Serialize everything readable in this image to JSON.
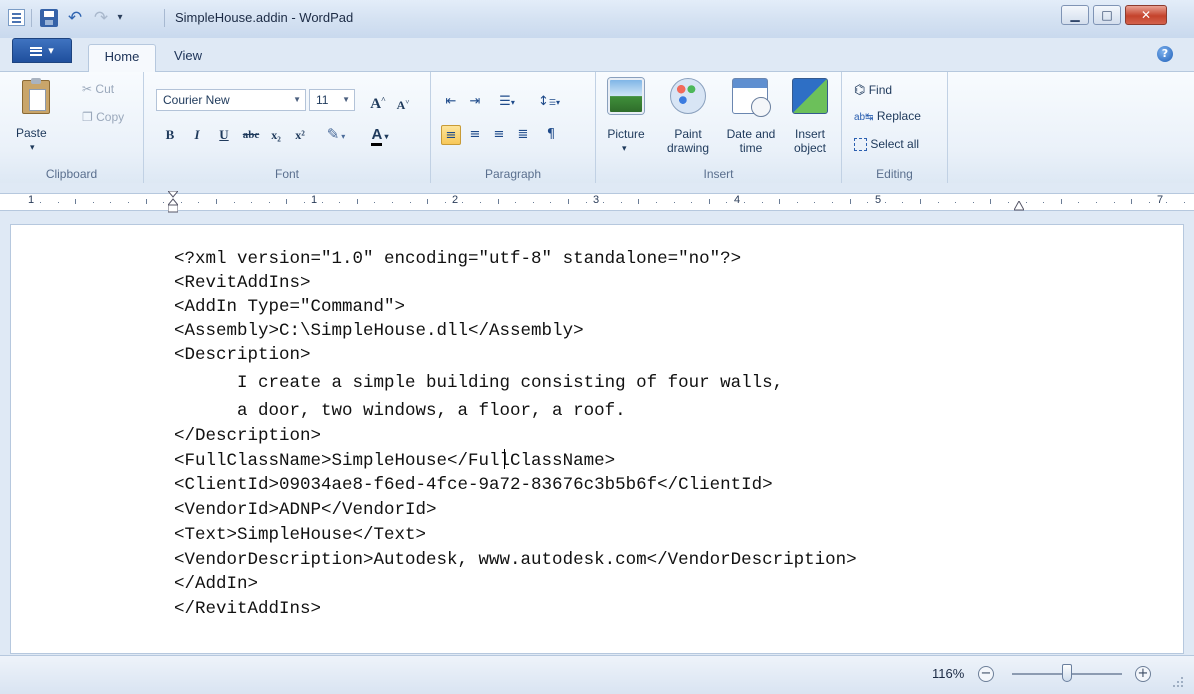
{
  "window": {
    "title": "SimpleHouse.addin - WordPad",
    "app_icon": "wordpad-icon",
    "quick_access": [
      "save-icon",
      "undo-icon",
      "redo-icon",
      "customize-dropdown-icon"
    ],
    "controls": {
      "minimize": "▁",
      "maximize": "□",
      "close": "✕"
    }
  },
  "ribbon": {
    "tabs": [
      {
        "label": "Home",
        "selected": true
      },
      {
        "label": "View",
        "selected": false
      }
    ],
    "help": "?",
    "clipboard": {
      "paste": "Paste",
      "cut": "Cut",
      "copy": "Copy",
      "group_label": "Clipboard"
    },
    "font": {
      "family": "Courier New",
      "size": "11",
      "grow": "A",
      "shrink": "A",
      "bold": "B",
      "italic": "I",
      "underline": "U",
      "strikethrough": "abc",
      "subscript": "x₂",
      "superscript": "x²",
      "color_letter": "A",
      "group_label": "Font"
    },
    "paragraph": {
      "group_label": "Paragraph",
      "active_alignment": "left"
    },
    "insert": {
      "picture": "Picture",
      "paint": [
        "Paint",
        "drawing"
      ],
      "datetime": [
        "Date and",
        "time"
      ],
      "object": [
        "Insert",
        "object"
      ],
      "group_label": "Insert"
    },
    "editing": {
      "find": "Find",
      "replace": "Replace",
      "select_all": "Select all",
      "group_label": "Editing"
    }
  },
  "ruler": {
    "numbers": [
      "1",
      "1",
      "2",
      "3",
      "4",
      "5",
      "7"
    ]
  },
  "document": {
    "lines": [
      "<?xml version=\"1.0\" encoding=\"utf-8\" standalone=\"no\"?>",
      "<RevitAddIns>",
      "<AddIn Type=\"Command\">",
      "<Assembly>C:\\SimpleHouse.dll</Assembly>",
      "<Description>",
      "      I create a simple building consisting of four walls,",
      "      a door, two windows, a floor, a roof.",
      "</Description>",
      "<FullClassName>SimpleHouse</FullClassName>",
      "<ClientId>09034ae8-f6ed-4fce-9a72-83676c3b5b6f</ClientId>",
      "<VendorId>ADNP</VendorId>",
      "<Text>SimpleHouse</Text>",
      "<VendorDescription>Autodesk, www.autodesk.com</VendorDescription>",
      "</AddIn>",
      "</RevitAddIns>"
    ]
  },
  "status": {
    "zoom": "116%",
    "zoom_out": "−",
    "zoom_in": "+",
    "zoom_fraction": 0.5
  },
  "colors": {
    "accent": "#1f4f9d",
    "ribbon_bg": "#eaf1f9",
    "active_button": "#f8c859"
  }
}
